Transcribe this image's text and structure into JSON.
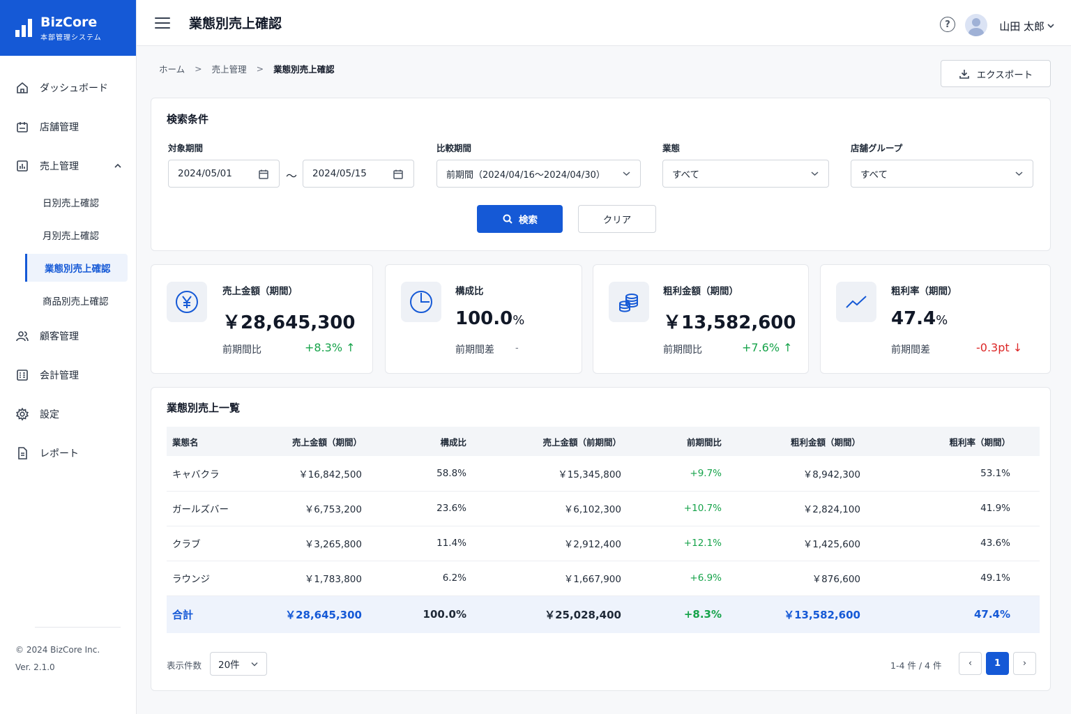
{
  "app": {
    "name": "BizCore",
    "subtitle": "本部管理システム"
  },
  "header": {
    "title": "業態別売上確認",
    "help_glyph": "?",
    "user_name": "山田 太郎"
  },
  "sidebar": {
    "items": [
      {
        "label": "ダッシュボード",
        "icon": "home-icon"
      },
      {
        "label": "店舗管理",
        "icon": "store-icon"
      },
      {
        "label": "売上管理",
        "icon": "sales-chart-icon"
      },
      {
        "label": "顧客管理",
        "icon": "users-icon"
      },
      {
        "label": "会計管理",
        "icon": "ledger-icon"
      },
      {
        "label": "設定",
        "icon": "gear-icon"
      },
      {
        "label": "レポート",
        "icon": "report-icon"
      }
    ],
    "sub_items": [
      "日別売上確認",
      "月別売上確認",
      "業態別売上確認",
      "商品別売上確認"
    ],
    "footer_copyright": "© 2024 BizCore Inc.",
    "footer_version": "Ver. 2.1.0"
  },
  "breadcrumb": {
    "home": "ホーム",
    "parent": "売上管理",
    "current": "業態別売上確認",
    "separator": ">"
  },
  "toolbar": {
    "export_label": "エクスポート"
  },
  "search": {
    "title": "検索条件",
    "period_label": "対象期間",
    "date_from": "2024/05/01",
    "date_to": "2024/05/15",
    "range_separator": "～",
    "compare_label": "比較期間",
    "compare_value": "前期間（2024/04/16～2024/04/30）",
    "type_label": "業態",
    "type_value": "すべて",
    "group_label": "店舗グループ",
    "group_value": "すべて",
    "search_button": "検索",
    "clear_button": "クリア"
  },
  "kpis": [
    {
      "label": "売上金額（期間）",
      "value": "￥28,645,300",
      "unit": "",
      "compare_label": "前期間比",
      "delta": "+8.3%",
      "arrow": "↑",
      "trend": "up",
      "icon": "yen-icon"
    },
    {
      "label": "構成比",
      "value": "100.0",
      "unit": "%",
      "compare_label": "前期間差",
      "delta": "-",
      "arrow": "",
      "trend": "none",
      "icon": "pie-icon"
    },
    {
      "label": "粗利金額（期間）",
      "value": "￥13,582,600",
      "unit": "",
      "compare_label": "前期間比",
      "delta": "+7.6%",
      "arrow": "↑",
      "trend": "up",
      "icon": "coins-icon"
    },
    {
      "label": "粗利率（期間）",
      "value": "47.4",
      "unit": "%",
      "compare_label": "前期間差",
      "delta": "-0.3pt",
      "arrow": "↓",
      "trend": "down",
      "icon": "trend-icon"
    }
  ],
  "table": {
    "title": "業態別売上一覧",
    "columns": [
      "業態名",
      "売上金額（期間）",
      "構成比",
      "売上金額（前期間）",
      "前期間比",
      "粗利金額（期間）",
      "粗利率（期間）"
    ],
    "rows": [
      [
        "キャバクラ",
        "￥16,842,500",
        "58.8%",
        "￥15,345,800",
        "+9.7%",
        "￥8,942,300",
        "53.1%"
      ],
      [
        "ガールズバー",
        "￥6,753,200",
        "23.6%",
        "￥6,102,300",
        "+10.7%",
        "￥2,824,100",
        "41.9%"
      ],
      [
        "クラブ",
        "￥3,265,800",
        "11.4%",
        "￥2,912,400",
        "+12.1%",
        "￥1,425,600",
        "43.6%"
      ],
      [
        "ラウンジ",
        "￥1,783,800",
        "6.2%",
        "￥1,667,900",
        "+6.9%",
        "￥876,600",
        "49.1%"
      ]
    ],
    "total": [
      "合計",
      "￥28,645,300",
      "100.0%",
      "￥25,028,400",
      "+8.3%",
      "￥13,582,600",
      "47.4%"
    ]
  },
  "pagination": {
    "per_page_label": "表示件数",
    "per_page_value": "20件",
    "info": "1-4 件 / 4 件",
    "prev": "‹",
    "current_page": "1",
    "next": "›"
  },
  "colors": {
    "primary": "#1559d6",
    "positive": "#16a34a",
    "negative": "#dc2626"
  }
}
